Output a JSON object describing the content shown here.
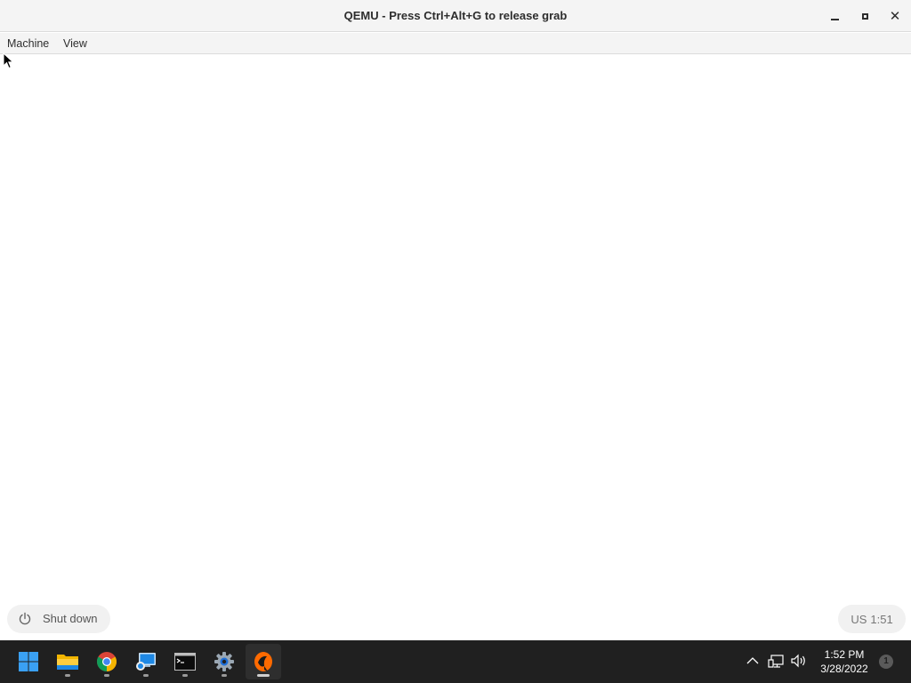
{
  "window": {
    "title": "QEMU - Press Ctrl+Alt+G to release grab",
    "controls": [
      "minimize-icon",
      "maximize-icon",
      "close-icon"
    ]
  },
  "menubar": {
    "items": [
      {
        "label": "Machine"
      },
      {
        "label": "View"
      }
    ]
  },
  "vm_screen": {
    "background": "#ffffff",
    "shutdown_label": "Shut down",
    "keyboard_layout": "US",
    "time": "1:51"
  },
  "taskbar": {
    "background": "#202020",
    "apps": [
      {
        "icon": "windows-start-icon"
      },
      {
        "icon": "file-explorer-icon"
      },
      {
        "icon": "chrome-icon"
      },
      {
        "icon": "remote-desktop-icon"
      },
      {
        "icon": "terminal-icon"
      },
      {
        "icon": "settings-gear-icon"
      },
      {
        "icon": "qemu-icon"
      }
    ],
    "tray": {
      "time": "1:52 PM",
      "date": "3/28/2022",
      "notification_count": "1"
    }
  }
}
